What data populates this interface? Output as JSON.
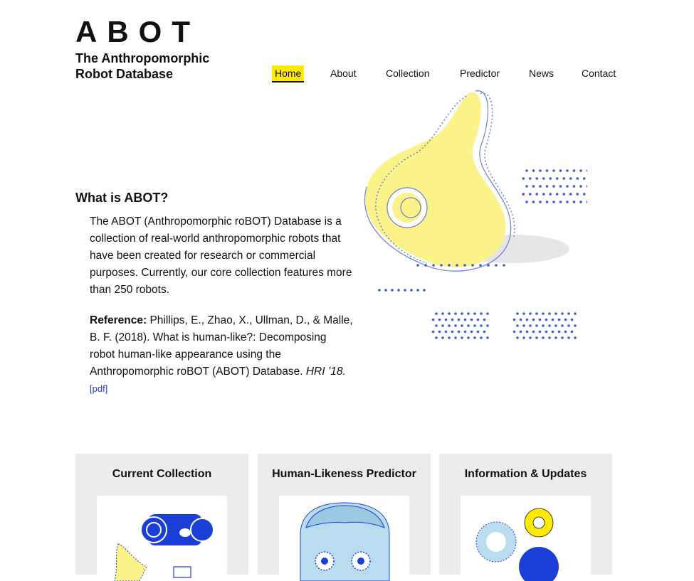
{
  "header": {
    "logo": "ABOT",
    "tagline": "The Anthropomorphic Robot Database"
  },
  "nav": {
    "items": [
      {
        "label": "Home",
        "active": true
      },
      {
        "label": "About"
      },
      {
        "label": "Collection"
      },
      {
        "label": "Predictor"
      },
      {
        "label": "News"
      },
      {
        "label": "Contact"
      }
    ]
  },
  "intro": {
    "title": "What is ABOT?",
    "body": "The ABOT (Anthropomorphic roBOT) Database is a collection of real-world anthropomorphic robots that have been created for research or commercial purposes. Currently, our core collection features more than 250 robots.",
    "reference_label": "Reference:",
    "reference_text": "Phillips, E., Zhao, X., Ullman, D., & Malle, B. F. (2018). What is human-like?: Decomposing robot human-like appearance using the Anthropomorphic roBOT (ABOT) Database.",
    "venue": "HRI ’18.",
    "pdf_label": "[pdf]"
  },
  "cards": [
    {
      "title": "Current Collection"
    },
    {
      "title": "Human-Likeness Predictor"
    },
    {
      "title": "Information & Updates"
    }
  ],
  "colors": {
    "accent_yellow": "#ffea00",
    "blob_yellow": "#fbf38a",
    "dot_blue": "#3b5bdb",
    "link_blue": "#1a3fd6",
    "card_bg": "#ececec"
  }
}
